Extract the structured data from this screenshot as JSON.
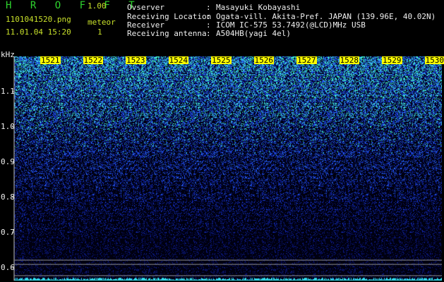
{
  "header": {
    "app_title": "H R O F F T",
    "app_version": "1.00",
    "filename": "1101041520.png",
    "meteor_label": "meteor",
    "datetime": "11.01.04 15:20",
    "meteor_count": "1"
  },
  "info": [
    {
      "label": "Ovserver",
      "sep": ":",
      "value": "Masayuki Kobayashi"
    },
    {
      "label": "Receiving Location",
      "sep": ":",
      "value": "Ogata-vill. Akita-Pref. JAPAN (139.96E, 40.02N)"
    },
    {
      "label": "Receiver",
      "sep": ":",
      "value": "ICOM IC-575 53.7492(@LCD)MHz USB"
    },
    {
      "label": "Receiving antenna",
      "sep": ":",
      "value": "A504HB(yagi 4el)"
    }
  ],
  "spectrogram": {
    "y_unit": "kHz",
    "y_ticks": [
      "1.1",
      "1.0",
      "0.9",
      "0.8",
      "0.7",
      "0.6"
    ],
    "y_values": [
      1.1,
      1.0,
      0.9,
      0.8,
      0.7,
      0.6
    ],
    "x_ticks": [
      "1521",
      "1522",
      "1523",
      "1524",
      "1525",
      "1526",
      "1527",
      "1528",
      "1529",
      "1530"
    ],
    "colors": {
      "background": "#000000",
      "low": "#0a0a6e",
      "mid": "#1e3cff",
      "high": "#40ffd0",
      "tick_box": "#ffff00",
      "marker_line": "#8a8a8a"
    }
  }
}
